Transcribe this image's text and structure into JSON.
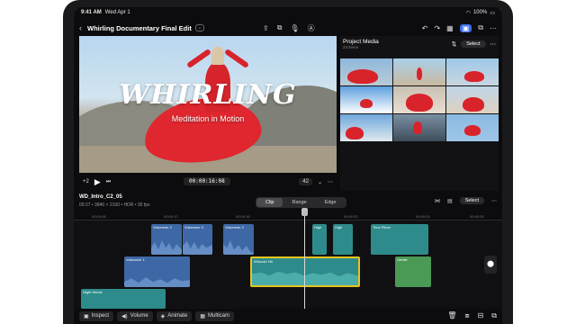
{
  "status": {
    "time": "9:41 AM",
    "date": "Wed Apr 1",
    "battery": "100%"
  },
  "header": {
    "title": "Whirling Documentary Final Edit",
    "back_icon": "chevron-left-icon"
  },
  "viewer": {
    "title": "WHIRLING",
    "subtitle": "Meditation in Motion",
    "timecode": "00:00:16:08",
    "zoom": "42",
    "frame_left": "+2"
  },
  "browser": {
    "title": "Project Media",
    "count": "23 items",
    "select_label": "Select"
  },
  "timeline": {
    "clip_name": "WD_Intro_C2_05",
    "clip_meta": "00:27 • 3840 × 2160 • HDR • 30 fps",
    "modes": [
      "Clip",
      "Range",
      "Edge"
    ],
    "select_label": "Select",
    "ruler": [
      "00:00:08",
      "00:00:12",
      "00:00:16",
      "00:00:20",
      "00:00:24",
      "00:00:28"
    ],
    "clips": {
      "voiceover2a": "Voiceover 2",
      "voiceover3": "Voiceover 3",
      "voiceover2b": "Voiceover 2",
      "high_a": "High",
      "high_b": "High",
      "time_piece": "Time Piece",
      "voiceover1": "Voiceover 1",
      "whoosh": "Whoosh Hit",
      "gentle": "Gentle",
      "night_winds": "Night Winds"
    }
  },
  "toolbar": {
    "inspect": "Inspect",
    "volume": "Volume",
    "animate": "Animate",
    "multicam": "Multicam"
  },
  "colors": {
    "accent": "#3b6df0",
    "clip_blue": "#3d68a5",
    "clip_teal": "#2e8b8b",
    "clip_green": "#4a9a55",
    "red": "#e0262e"
  }
}
